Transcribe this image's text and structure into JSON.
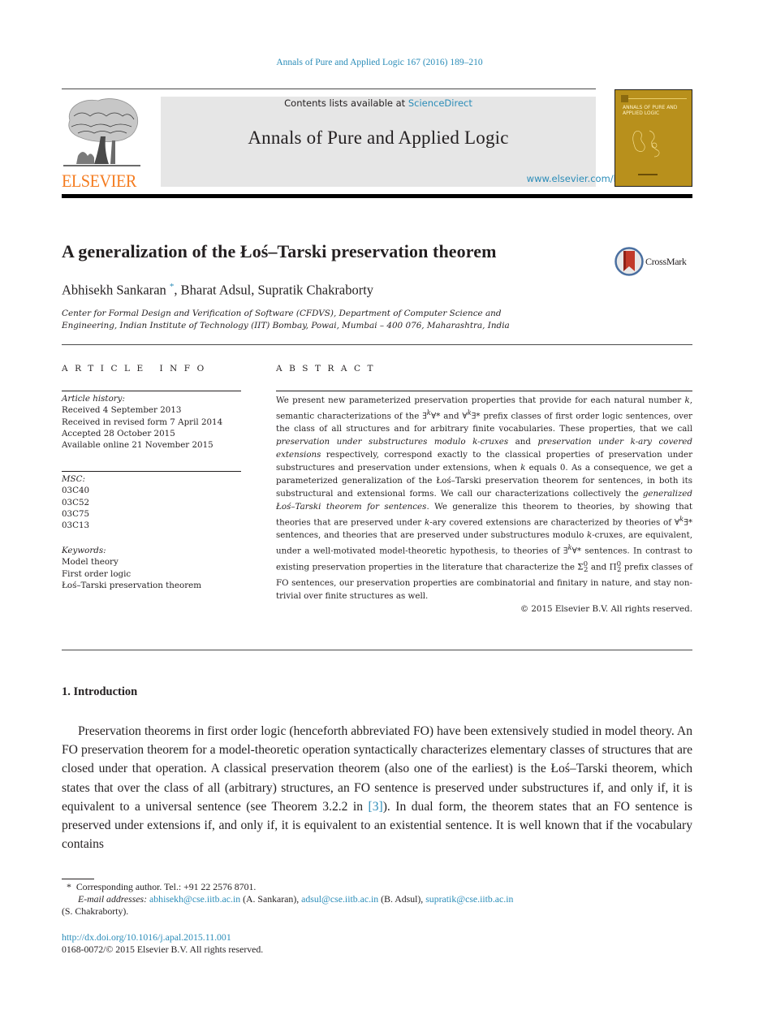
{
  "header": {
    "journal_reference": "Annals of Pure and Applied Logic 167 (2016) 189–210",
    "contents_prefix": "Contents lists available at ",
    "contents_link": "ScienceDirect",
    "journal_name": "Annals of Pure and Applied Logic",
    "journal_url": "www.elsevier.com/locate/apal",
    "publisher_logo_text": "ELSEVIER",
    "cover_title": "ANNALS OF PURE AND APPLIED LOGIC",
    "crossmark_label": "CrossMark"
  },
  "colors": {
    "link": "#2a8cb8",
    "elsevier_orange": "#f47c20",
    "masthead_bg": "#e6e6e6",
    "cover_gold": "#b8901c"
  },
  "article": {
    "title": "A generalization of the Łoś–Tarski preservation theorem",
    "authors": [
      {
        "name": "Abhisekh Sankaran",
        "mark": "*"
      },
      {
        "name": "Bharat Adsul"
      },
      {
        "name": "Supratik Chakraborty"
      }
    ],
    "affiliation_line1": "Center for Formal Design and Verification of Software (CFDVS), Department of Computer Science and",
    "affiliation_line2": "Engineering, Indian Institute of Technology (IIT) Bombay, Powai, Mumbai – 400 076, Maharashtra, India"
  },
  "article_info": {
    "heading": "ARTICLE INFO",
    "history_label": "Article history:",
    "history": [
      "Received 4 September 2013",
      "Received in revised form 7 April 2014",
      "Accepted 28 October 2015",
      "Available online 21 November 2015"
    ],
    "msc_label": "MSC:",
    "msc": [
      "03C40",
      "03C52",
      "03C75",
      "03C13"
    ],
    "keywords_label": "Keywords:",
    "keywords": [
      "Model theory",
      "First order logic",
      "Łoś–Tarski preservation theorem"
    ]
  },
  "abstract": {
    "heading": "ABSTRACT",
    "p1": "We present new parameterized preservation properties that provide for each natural number ",
    "k1": "k",
    "p2": ", semantic characterizations of the ∃",
    "p2b": "∀* and ∀",
    "p2c": "∃* prefix classes of first order logic sentences, over the class of all structures and for arbitrary finite vocabularies. These properties, that we call ",
    "i1": "preservation under substructures modulo k-cruxes",
    "p3": " and ",
    "i2": "preservation under k-ary covered extensions",
    "p4": " respectively, correspond exactly to the classical properties of preservation under substructures and preservation under extensions, when ",
    "p5": " equals 0. As a consequence, we get a parameterized generalization of the Łoś–Tarski preservation theorem for sentences, in both its substructural and extensional forms. We call our characterizations collectively the ",
    "i3": "generalized Łoś–Tarski theorem for sentences",
    "p6": ". We generalize this theorem to theories, by showing that theories that are preserved under ",
    "p7": "-ary covered extensions are characterized by theories of ∀",
    "p8": "∃* sentences, and theories that are preserved under substructures modulo ",
    "p9": "-cruxes, are equivalent, under a well-motivated model-theoretic hypothesis, to theories of ∃",
    "p10": "∀* sentences. In contrast to existing preservation properties in the literature that characterize the Σ",
    "p11": " and Π",
    "p12": " prefix classes of FO sentences, our preservation properties are combinatorial and finitary in nature, and stay non-trivial over finite structures as well.",
    "sub2": "2",
    "sup0": "0",
    "copyright": "© 2015 Elsevier B.V. All rights reserved."
  },
  "intro": {
    "heading": "1. Introduction",
    "text_a": "Preservation theorems in first order logic (henceforth abbreviated FO) have been extensively studied in model theory. An FO preservation theorem for a model-theoretic operation syntactically characterizes elementary classes of structures that are closed under that operation. A classical preservation theorem (also one of the earliest) is the Łoś–Tarski theorem, which states that over the class of all (arbitrary) structures, an FO sentence is preserved under substructures if, and only if, it is equivalent to a universal sentence (see Theorem 3.2.2 in ",
    "citation": "[3]",
    "text_b": "). In dual form, the theorem states that an FO sentence is preserved under extensions if, and only if, it is equivalent to an existential sentence. It is well known that if the vocabulary contains"
  },
  "footnotes": {
    "mark": "*",
    "corresponding": "Corresponding author. Tel.: +91 22 2576 8701.",
    "email_label": "E-mail addresses:",
    "emails": [
      {
        "address": "abhisekh@cse.iitb.ac.in",
        "who": " (A. Sankaran), "
      },
      {
        "address": "adsul@cse.iitb.ac.in",
        "who": " (B. Adsul), "
      },
      {
        "address": "supratik@cse.iitb.ac.in",
        "who": ""
      }
    ],
    "last_who": "(S. Chakraborty).",
    "doi": "http://dx.doi.org/10.1016/j.apal.2015.11.001",
    "issn_line": "0168-0072/© 2015 Elsevier B.V. All rights reserved."
  }
}
